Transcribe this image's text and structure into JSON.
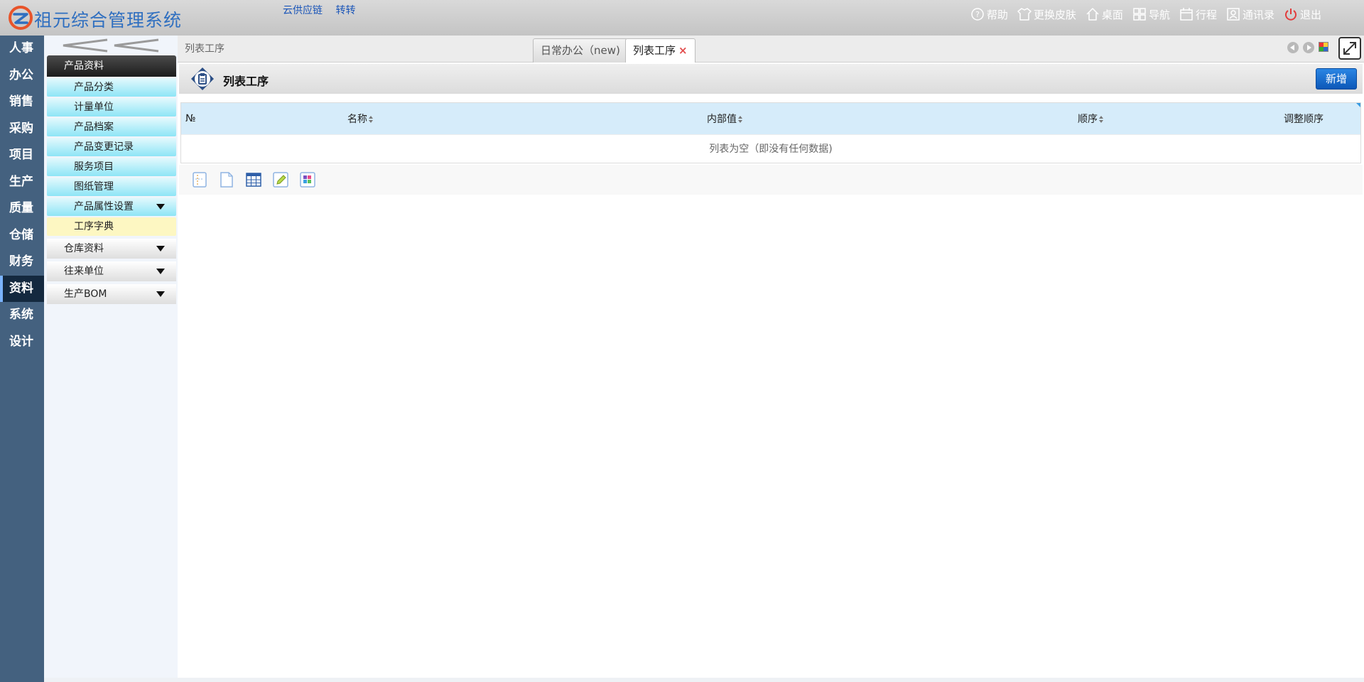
{
  "header": {
    "app_title": "祖元综合管理系统",
    "links": [
      "云供应链",
      "转转"
    ],
    "tools": {
      "help": "帮助",
      "skin": "更换皮肤",
      "desktop": "桌面",
      "nav": "导航",
      "schedule": "行程",
      "contacts": "通讯录",
      "logout": "退出"
    }
  },
  "leftnav": {
    "items": [
      "人事",
      "办公",
      "销售",
      "采购",
      "项目",
      "生产",
      "质量",
      "仓储",
      "财务",
      "资料",
      "系统",
      "设计"
    ],
    "active": "资料"
  },
  "submenu": {
    "section": "产品资料",
    "items": [
      "产品分类",
      "计量单位",
      "产品档案",
      "产品变更记录",
      "服务项目",
      "图纸管理",
      "产品属性设置",
      "工序字典"
    ],
    "selected": "工序字典",
    "groups": [
      "仓库资料",
      "往来单位",
      "生产BOM"
    ]
  },
  "tabs": {
    "breadcrumb": "列表工序",
    "items": [
      {
        "label": "日常办公（new)",
        "active": false
      },
      {
        "label": "列表工序",
        "active": true
      }
    ],
    "close_glyph": "×"
  },
  "page": {
    "title": "列表工序",
    "add_button": "新增"
  },
  "table": {
    "columns": [
      "№",
      "名称",
      "内部值",
      "顺序",
      "调整顺序"
    ],
    "empty_text": "列表为空（即没有任何数据)"
  },
  "colors": {
    "nav_bg": "#44617f",
    "nav_active": "#14293f",
    "accent_blue": "#1166c8",
    "submenu_item": "#8ee5f6",
    "selected_item": "#fdf7c2",
    "table_header": "#d6ecfa"
  }
}
